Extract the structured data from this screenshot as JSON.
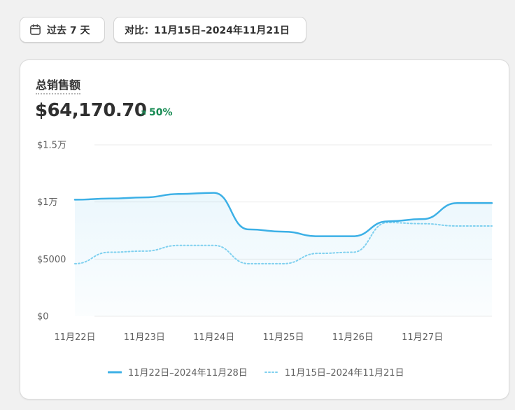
{
  "toolbar": {
    "range_label": "过去 7 天",
    "compare_label": "对比：11月15日–2024年11月21日"
  },
  "card": {
    "title": "总销售额",
    "total": "$64,170.70",
    "change": "50%"
  },
  "colors": {
    "primary_line": "#3cb0e6",
    "compare_line": "#7fd0ef",
    "positive": "#158a52",
    "grid": "#ebebeb"
  },
  "icons": {
    "range": "calendar-icon",
    "change": "arrow-up-right-icon"
  },
  "chart_data": {
    "type": "line",
    "categories": [
      "11月22日",
      "11月23日",
      "11月24日",
      "11月25日",
      "11月26日",
      "11月27日"
    ],
    "x": [
      0,
      0.5,
      1,
      1.5,
      2,
      2.5,
      3,
      3.5,
      4,
      4.5,
      5,
      5.5,
      6
    ],
    "yticks": [
      "$0",
      "$5000",
      "$1万",
      "$1.5万"
    ],
    "ylim": [
      0,
      15000
    ],
    "grid": true,
    "legend_position": "bottom",
    "series": [
      {
        "name": "11月22日–2024年11月28日",
        "style": "solid",
        "values": [
          10200,
          10300,
          10400,
          10700,
          10800,
          7600,
          7400,
          7000,
          7000,
          8300,
          8500,
          9900,
          9900
        ]
      },
      {
        "name": "11月15日–2024年11月21日",
        "style": "dotted",
        "values": [
          4600,
          5600,
          5700,
          6200,
          6200,
          4600,
          4600,
          5500,
          5600,
          8200,
          8100,
          7900,
          7900
        ]
      }
    ]
  }
}
